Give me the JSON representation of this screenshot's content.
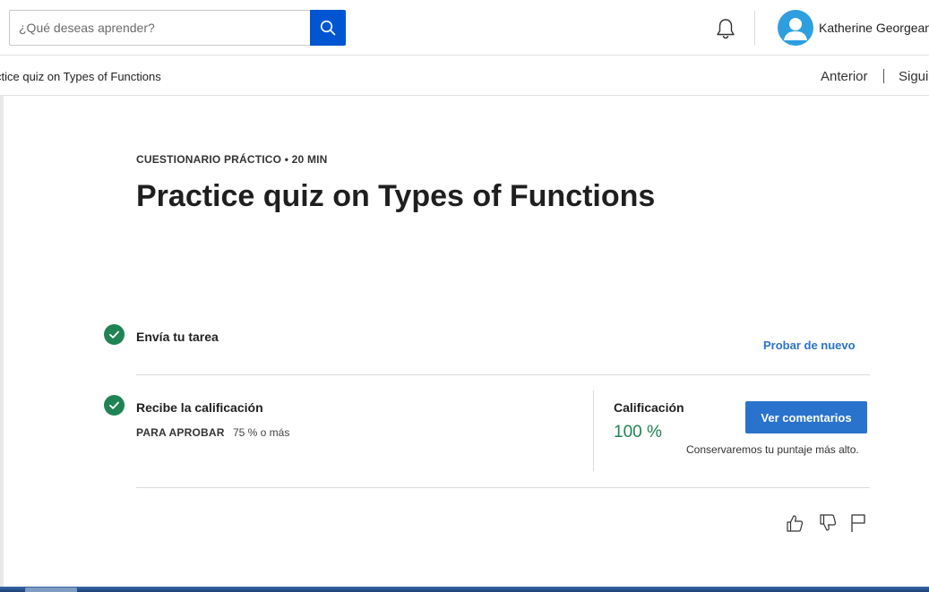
{
  "header": {
    "search": {
      "placeholder": "¿Qué deseas aprender?",
      "value": ""
    },
    "user_name": "Katherine Georgeana"
  },
  "nav": {
    "breadcrumb": "ctice quiz on Types of Functions",
    "prev_label": "Anterior",
    "next_label": "Siguie"
  },
  "main": {
    "eyebrow": "CUESTIONARIO PRÁCTICO • 20 MIN",
    "title": "Practice quiz on Types of Functions",
    "steps": [
      {
        "label": "Envía tu tarea",
        "status": "completed"
      },
      {
        "label": "Recibe la calificación",
        "status": "completed"
      }
    ],
    "retry_label": "Probar de nuevo",
    "pass_label": "PARA APROBAR",
    "pass_value": "75 % o más",
    "grade_label": "Calificación",
    "grade_value": "100 %",
    "feedback_button": "Ver comentarios",
    "keep_note": "Conservaremos tu puntaje más alto."
  },
  "icons": [
    "search-icon",
    "bell-icon",
    "user-icon",
    "check-icon",
    "thumbs-up-icon",
    "thumbs-down-icon",
    "flag-icon"
  ],
  "colors": {
    "primary": "#0056d2",
    "link": "#2a73cc",
    "success": "#1f8354",
    "avatar": "#2d9fe0"
  }
}
